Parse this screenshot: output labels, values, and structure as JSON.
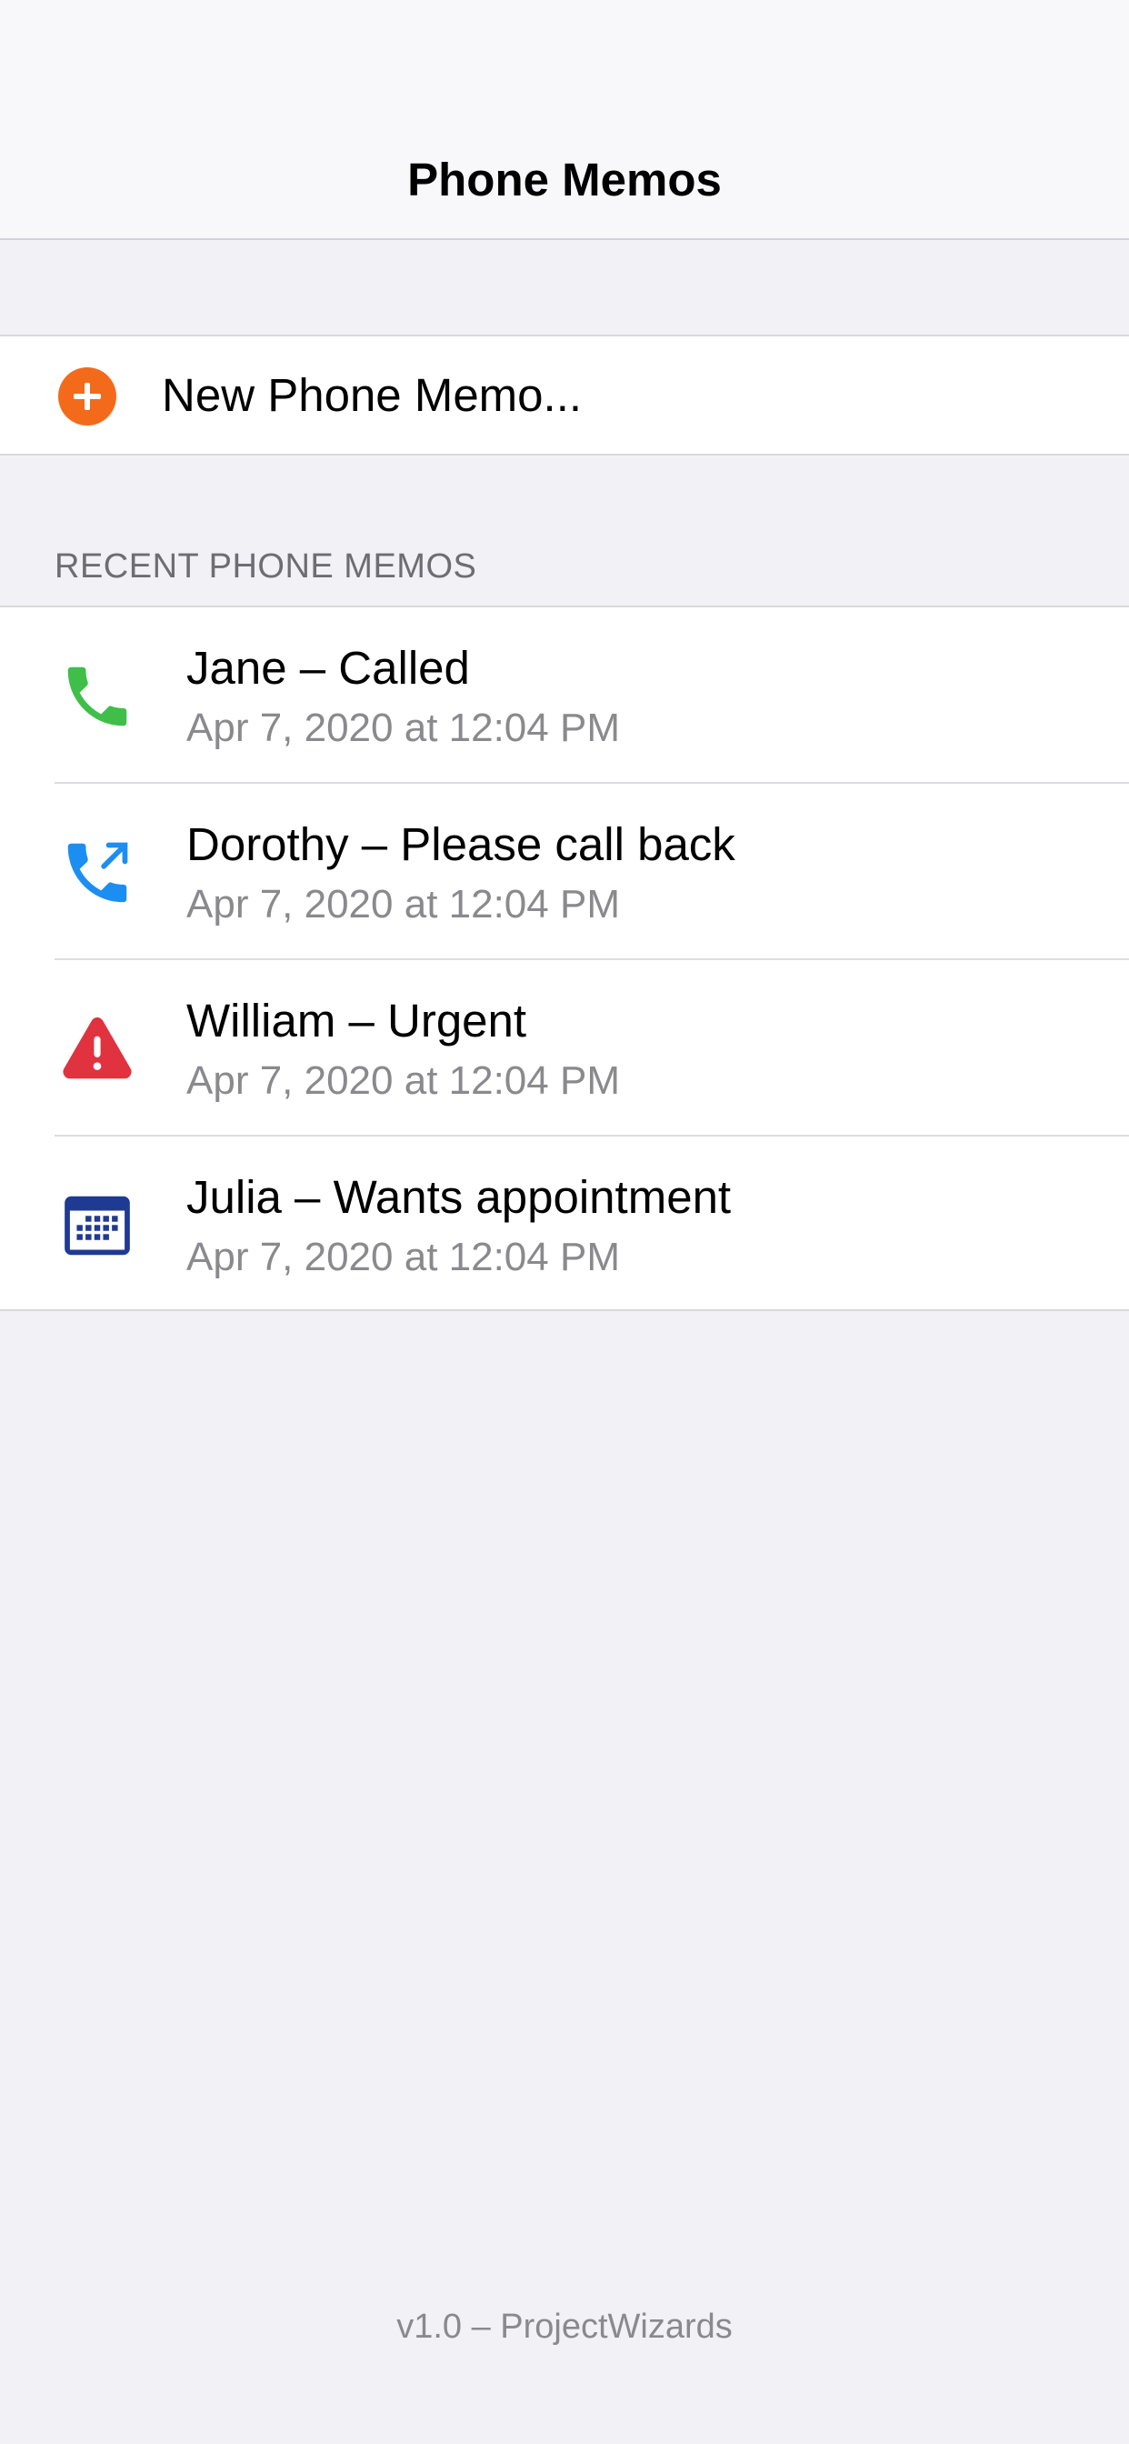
{
  "nav": {
    "title": "Phone Memos"
  },
  "new_memo": {
    "label": "New Phone Memo...",
    "icon": "plus-circle-icon",
    "icon_color": "#f46a1b"
  },
  "recent": {
    "header": "RECENT PHONE MEMOS",
    "items": [
      {
        "title": "Jane – Called",
        "date": "Apr 7, 2020 at 12:04 PM",
        "icon": "phone-icon",
        "icon_color": "#3fbf4a"
      },
      {
        "title": "Dorothy – Please call back",
        "date": "Apr 7, 2020 at 12:04 PM",
        "icon": "phone-callback-icon",
        "icon_color": "#1c8ef2"
      },
      {
        "title": "William – Urgent",
        "date": "Apr 7, 2020 at 12:04 PM",
        "icon": "warning-icon",
        "icon_color": "#e1323f"
      },
      {
        "title": "Julia – Wants appointment",
        "date": "Apr 7, 2020 at 12:04 PM",
        "icon": "calendar-icon",
        "icon_color": "#1f3a93"
      }
    ]
  },
  "footer": {
    "text": "v1.0 – ProjectWizards"
  }
}
